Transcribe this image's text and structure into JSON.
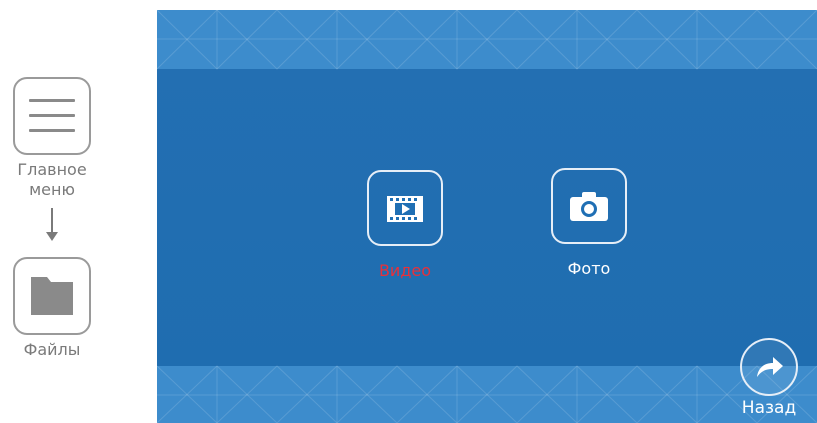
{
  "side": {
    "main_menu_label": "Главное меню",
    "files_label": "Файлы",
    "menu_icon": "hamburger-menu-icon",
    "files_icon": "folder-icon"
  },
  "screen": {
    "items": [
      {
        "label": "Видео",
        "icon": "video-film-icon",
        "color": "#e8303a",
        "selected": true
      },
      {
        "label": "Фото",
        "icon": "camera-icon",
        "color": "#ffffff",
        "selected": false
      }
    ],
    "back_label": "Назад",
    "back_icon": "share-arrow-icon",
    "colors": {
      "screen_bg": "#1f6fb4",
      "band_bg": "#3d8ccc",
      "selected_text": "#e8303a"
    }
  }
}
